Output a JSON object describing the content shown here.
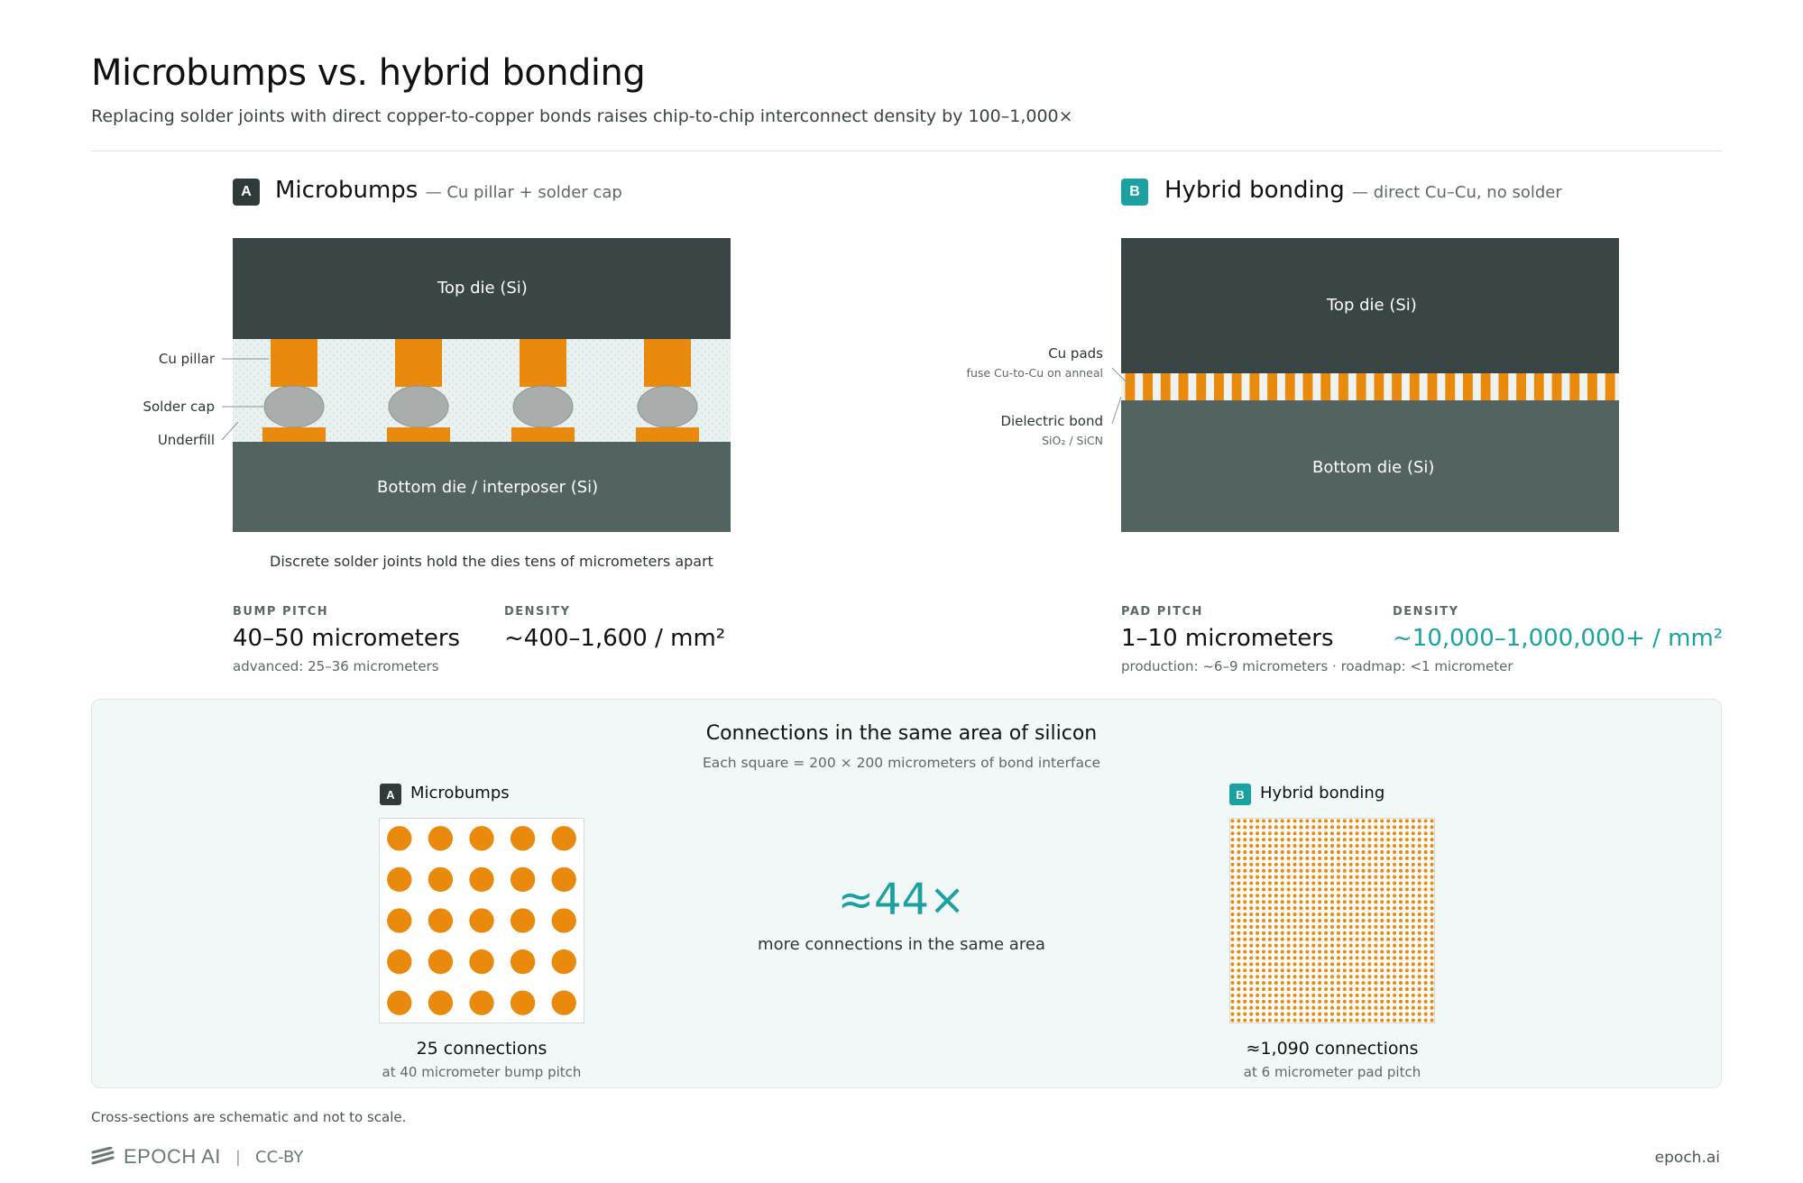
{
  "header": {
    "title": "Microbumps vs. hybrid bonding",
    "subtitle": "Replacing solder joints with direct copper-to-copper bonds raises chip-to-chip interconnect density by 100–1,000×"
  },
  "section_a": {
    "badge": "A",
    "title": "Microbumps",
    "subtitle": "— Cu pillar + solder cap",
    "top_die": "Top die (Si)",
    "bottom_die": "Bottom die / interposer (Si)",
    "labels": {
      "pillar": "Cu pillar",
      "solder": "Solder cap",
      "underfill": "Underfill"
    },
    "caption": "Discrete solder joints hold the dies tens of micrometers apart",
    "stats": {
      "pitch_header": "BUMP PITCH",
      "pitch_value": "40–50 micrometers",
      "pitch_note": "advanced: 25–36 micrometers",
      "density_header": "DENSITY",
      "density_value": "~400–1,600 / mm²"
    }
  },
  "section_b": {
    "badge": "B",
    "title": "Hybrid bonding",
    "subtitle": "— direct Cu–Cu, no solder",
    "top_die": "Top die (Si)",
    "bottom_die": "Bottom die (Si)",
    "labels": {
      "pads": "Cu pads",
      "pads_note": "fuse Cu-to-Cu on anneal",
      "dielectric": "Dielectric bond",
      "dielectric_note": "SiO₂ / SiCN"
    },
    "stats": {
      "pitch_header": "PAD PITCH",
      "pitch_value": "1–10 micrometers",
      "pitch_note": "production: ~6–9 micrometers · roadmap: <1 micrometer",
      "density_header": "DENSITY",
      "density_value": "~10,000–1,000,000+ / mm²"
    }
  },
  "comparison": {
    "title": "Connections in the same area of silicon",
    "subtitle": "Each square = 200 × 200 micrometers of bond interface",
    "left": {
      "badge": "A",
      "label": "Microbumps",
      "count": "25 connections",
      "note": "at 40 micrometer bump pitch",
      "grid_n": 5
    },
    "right": {
      "badge": "B",
      "label": "Hybrid bonding",
      "count": "≈1,090 connections",
      "note": "at 6 micrometer pad pitch",
      "grid_n": 33
    },
    "ratio": "≈44×",
    "ratio_note": "more connections in the same area"
  },
  "footer": {
    "note": "Cross-sections are schematic and not to scale.",
    "logo": "EPOCH AI",
    "license": "CC-BY",
    "site": "epoch.ai"
  },
  "colors": {
    "copper": "#ea8a0c",
    "solder": "#a9adab",
    "top_die": "#3a4645",
    "bottom_die": "#536362",
    "teal": "#1ba2a0",
    "underfill": "#e9f2f1"
  }
}
